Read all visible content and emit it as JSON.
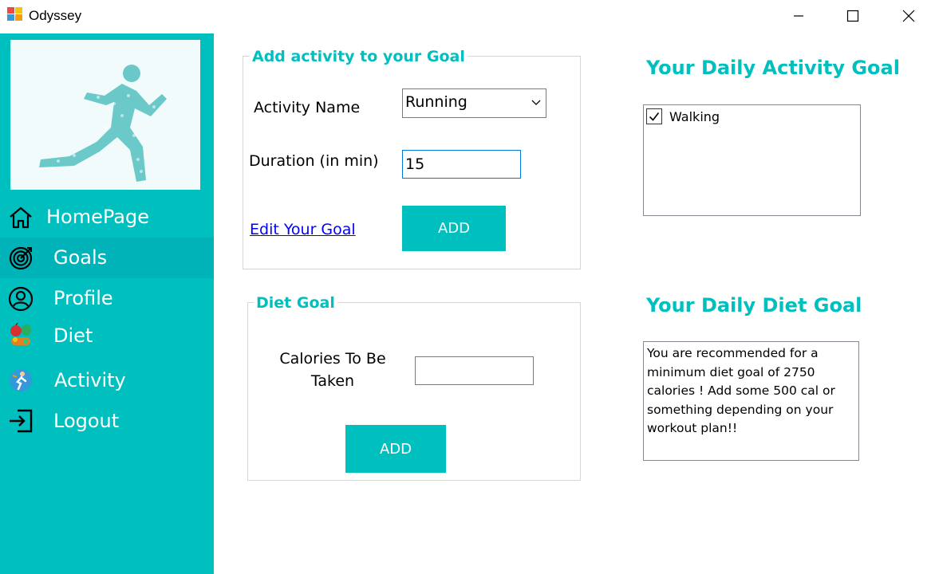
{
  "window": {
    "title": "Odyssey",
    "icon": "windows-app-icon",
    "controls": [
      "minimize-icon",
      "maximize-icon",
      "close-icon"
    ]
  },
  "sidebar": {
    "background": "#00BFBF",
    "active_background": "#00B3B8",
    "hero_image": "runner-silhouette-image",
    "items": [
      {
        "label": "HomePage",
        "icon": "home-icon"
      },
      {
        "label": "Goals",
        "icon": "target-icon",
        "active": true
      },
      {
        "label": "Profile",
        "icon": "user-icon"
      },
      {
        "label": "Diet",
        "icon": "fruits-vegetables-icon"
      },
      {
        "label": "Activity",
        "icon": "runner-badge-icon"
      },
      {
        "label": "Logout",
        "icon": "logout-icon"
      }
    ]
  },
  "activity_group": {
    "legend": "Add activity to your Goal",
    "activity_name_label": "Activity Name",
    "activity_name_value": "Running",
    "duration_label": "Duration (in min)",
    "duration_value": "15",
    "edit_link": "Edit Your Goal",
    "add_button": "ADD"
  },
  "diet_group": {
    "legend": "Diet Goal",
    "calories_label_line1": "Calories To Be",
    "calories_label_line2": "Taken",
    "calories_value": "",
    "add_button": "ADD"
  },
  "daily_activity": {
    "heading": "Your Daily Activity Goal",
    "items": [
      {
        "label": "Walking",
        "checked": true
      }
    ]
  },
  "daily_diet": {
    "heading": "Your Daily Diet Goal",
    "text": "You are recommended for a minimum diet goal of 2750 calories ! Add some 500 cal or something depending on your workout plan!!"
  },
  "colors": {
    "accent": "#00BFBF",
    "link": "#0000FF",
    "focus_border": "#0078D7"
  }
}
